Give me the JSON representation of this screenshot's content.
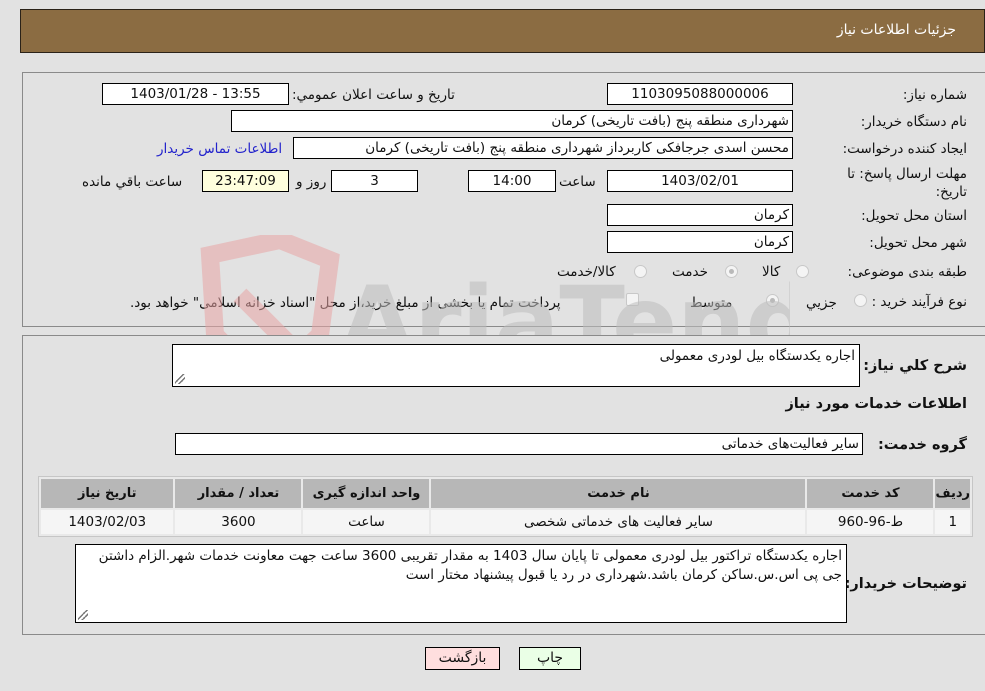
{
  "header": {
    "title": "جزئیات اطلاعات نیاز"
  },
  "form": {
    "need_number": {
      "label": "شماره نیاز:",
      "value": "1103095088000006"
    },
    "announce_datetime": {
      "label": "تاریخ و ساعت اعلان عمومي:",
      "value": "1403/01/28 - 13:55"
    },
    "buyer_org": {
      "label": "نام دستگاه خريدار:",
      "value": "شهرداری منطقه پنج (بافت تاریخی) کرمان"
    },
    "requester": {
      "label": "ایجاد کننده درخواست:",
      "value": "محسن اسدی جرجافکی کاربرداز شهرداری منطقه پنج (بافت تاریخی) کرمان"
    },
    "buyer_contact_link": "اطلاعات تماس خريدار",
    "deadline": {
      "label": "مهلت ارسال پاسخ: تا تاریخ:",
      "date": "1403/02/01",
      "time_label": "ساعت",
      "time": "14:00",
      "days": "3",
      "days_label": "روز و",
      "remaining": "23:47:09",
      "remaining_label": "ساعت باقي مانده"
    },
    "province": {
      "label": "استان محل تحویل:",
      "value": "کرمان"
    },
    "city": {
      "label": "شهر محل تحویل:",
      "value": "کرمان"
    },
    "category": {
      "label": "طبقه بندی موضوعی:",
      "options": [
        "کالا",
        "خدمت",
        "کالا/خدمت"
      ],
      "selected": "خدمت"
    },
    "purchase_type": {
      "label": "نوع فرآیند خرید :",
      "options": [
        "جزيي",
        "متوسط"
      ],
      "selected": "متوسط",
      "treasury_note": "پرداخت تمام یا بخشی از مبلغ خرید،از محل \"اسناد خزانه اسلامی\" خواهد بود.",
      "treasury_checked": false
    }
  },
  "details": {
    "summary_label": "شرح کلي نياز:",
    "summary_value": "اجاره یکدستگاه بیل لودری معمولی",
    "services_title": "اطلاعات خدمات مورد نیاز",
    "service_group_label": "گروه خدمت:",
    "service_group_value": "سایر فعالیت‌های خدماتی",
    "table": {
      "headers": [
        "رديف",
        "کد خدمت",
        "نام خدمت",
        "واحد اندازه گیری",
        "تعداد / مقدار",
        "تاریخ نیاز"
      ],
      "rows": [
        [
          "1",
          "ط-96-960",
          "سایر فعالیت های خدماتی شخصی",
          "ساعت",
          "3600",
          "1403/02/03"
        ]
      ]
    },
    "buyer_notes_label": "توضیحات خریدار:",
    "buyer_notes_value": "اجاره یکدستگاه تراکتور بیل لودری معمولی تا پایان سال 1403 به مقدار تقریبی 3600 ساعت جهت معاونت خدمات شهر.الزام داشتن جی پی اس.س.ساکن کرمان باشد.شهرداری در رد یا قبول پیشنهاد مختار است"
  },
  "buttons": {
    "print": "چاپ",
    "back": "بازگشت"
  },
  "watermark": "AriaTender.neT",
  "colors": {
    "header_bg": "#8b6c42",
    "back_btn": "#ffdede",
    "print_btn": "#eaffe6",
    "link": "#2222cc"
  }
}
